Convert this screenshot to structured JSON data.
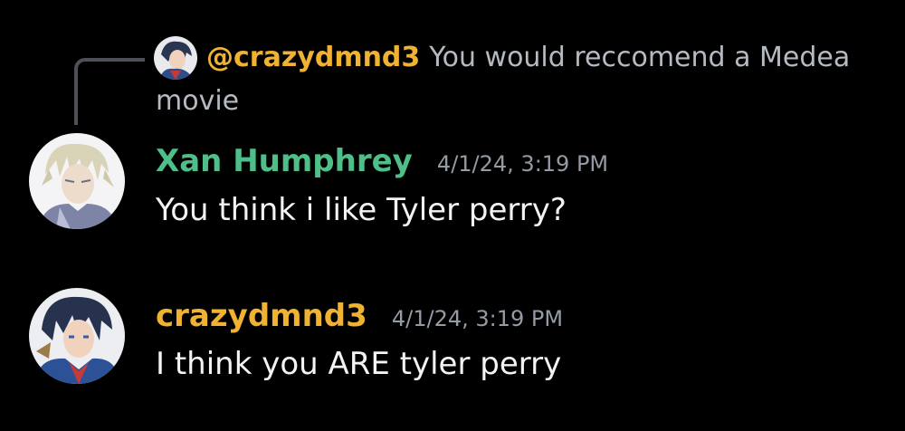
{
  "colors": {
    "background": "#000000",
    "mention": "#f0b232",
    "xan_name": "#4fbf8a",
    "crazy_name": "#f0b232",
    "timestamp": "#949ba4",
    "reply_text": "#b5bac1",
    "message_text": "#f2f3f5"
  },
  "reply": {
    "avatar_icon": "avatar-crazydmnd3-icon",
    "mention": "@crazydmnd3",
    "text": "You would reccomend a Medea movie"
  },
  "messages": [
    {
      "username": "Xan Humphrey",
      "timestamp": "4/1/24, 3:19 PM",
      "text": "You think i like Tyler perry?",
      "avatar_icon": "avatar-xan-humphrey-icon"
    },
    {
      "username": "crazydmnd3",
      "timestamp": "4/1/24, 3:19 PM",
      "text": "I think you ARE tyler perry",
      "avatar_icon": "avatar-crazydmnd3-icon"
    }
  ]
}
